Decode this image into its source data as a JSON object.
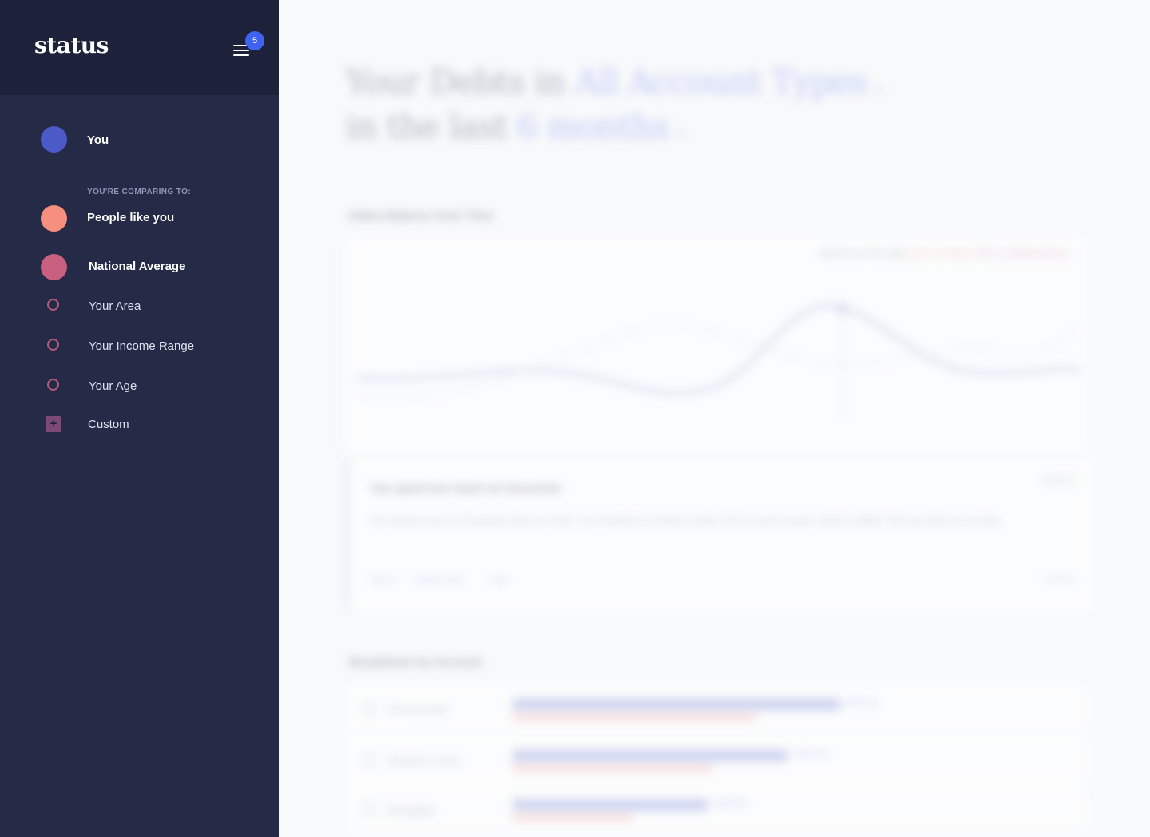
{
  "sidebar": {
    "logo": "status",
    "notification_count": "5",
    "you_label": "You",
    "comparing_heading": "YOU'RE COMPARING TO:",
    "groups": [
      {
        "label": "People like you",
        "selected": true,
        "color": "#f78f7e"
      },
      {
        "label": "National Average",
        "selected": true,
        "color": "#c9607f"
      },
      {
        "label": "Your Area",
        "selected": false
      },
      {
        "label": "Your Income Range",
        "selected": false
      },
      {
        "label": "Your Age",
        "selected": false
      }
    ],
    "custom_label": "Custom",
    "you_color": "#4b5ac6"
  },
  "main": {
    "headline_part1": "Your Debts in",
    "headline_accent1": "All Account Types",
    "headline_part2": "in the last",
    "headline_accent2": "6 months",
    "chart_section_title": "Debts Balance Over Time",
    "chart_note": "Based on this data",
    "chart_note_r1": "12% vs Peers",
    "chart_note_r2": "4% vs National Avg",
    "insight_title": "You spent too much on Groceries",
    "insight_body": "You spend more on Groceries than you earn. You should try to keep it under 10% of your income, which is $500. We can help you do that.",
    "insight_links": [
      "Tip #1",
      "Learn more",
      "Ask"
    ],
    "insight_meta_top": "Spotlight",
    "insight_meta_bottom": "Dismiss",
    "breakdown_title": "Breakdown by Account",
    "accounts": [
      {
        "name": "All Accounts",
        "value": "$54,210"
      },
      {
        "name": "Student Loans",
        "value": "$45,320"
      },
      {
        "name": "Mortgage",
        "value": "$32,600"
      }
    ]
  }
}
